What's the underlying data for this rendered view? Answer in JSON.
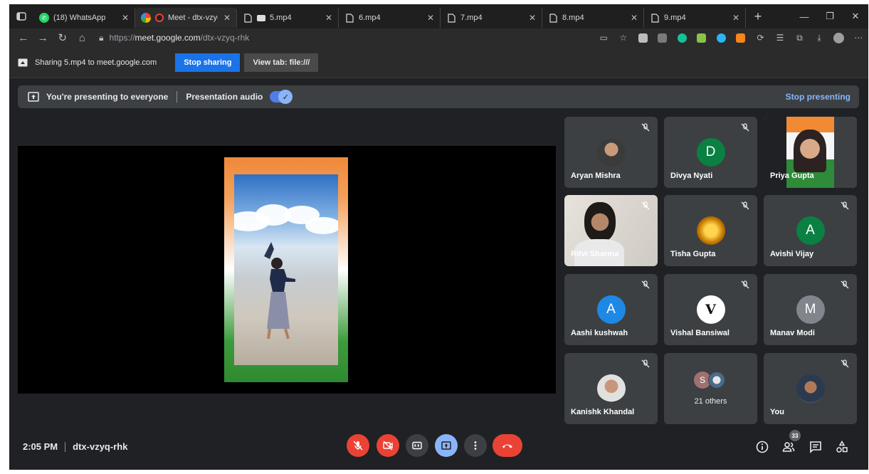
{
  "browser": {
    "tabs": [
      {
        "label": "(18) WhatsApp",
        "icon": "whatsapp-icon"
      },
      {
        "label": "Meet - dtx-vzyq-",
        "icon": "meet-icon",
        "active": true
      },
      {
        "label": "5.mp4",
        "icon": "file-icon"
      },
      {
        "label": "6.mp4",
        "icon": "file-icon"
      },
      {
        "label": "7.mp4",
        "icon": "file-icon"
      },
      {
        "label": "8.mp4",
        "icon": "file-icon"
      },
      {
        "label": "9.mp4",
        "icon": "file-icon"
      }
    ],
    "new_tab": "+",
    "url_prefix": "https://",
    "url_host": "meet.google.com",
    "url_path": "/dtx-vzyq-rhk"
  },
  "share_bar": {
    "text": "Sharing 5.mp4 to meet.google.com",
    "stop_label": "Stop sharing",
    "view_label": "View tab: file:///"
  },
  "presenting": {
    "text": "You're presenting to everyone",
    "audio_label": "Presentation audio",
    "audio_on": true,
    "stop_label": "Stop presenting"
  },
  "participants": [
    {
      "name": "Aryan Mishra",
      "type": "photo",
      "muted": true
    },
    {
      "name": "Divya Nyati",
      "type": "letter",
      "letter": "D",
      "color": "#0b8043",
      "muted": true
    },
    {
      "name": "Priya Gupta",
      "type": "video",
      "muted": true
    },
    {
      "name": "Ritvi Sharma",
      "type": "video",
      "muted": true
    },
    {
      "name": "Tisha Gupta",
      "type": "photo",
      "muted": true
    },
    {
      "name": "Avishi Vijay",
      "type": "letter",
      "letter": "A",
      "color": "#0b8043",
      "muted": true
    },
    {
      "name": "Aashi kushwah",
      "type": "letter",
      "letter": "A",
      "color": "#1e88e5",
      "muted": true
    },
    {
      "name": "Vishal Bansiwal",
      "type": "logo",
      "letter": "V",
      "muted": true
    },
    {
      "name": "Manav Modi",
      "type": "letter",
      "letter": "M",
      "color": "#80868b",
      "muted": true
    },
    {
      "name": "Kanishk Khandal",
      "type": "photo",
      "muted": true
    },
    {
      "name": "21 others",
      "type": "others",
      "letter": "S"
    },
    {
      "name": "You",
      "type": "photo",
      "muted": true
    }
  ],
  "footer": {
    "time": "2:05 PM",
    "meeting_code": "dtx-vzyq-rhk",
    "people_count": "33"
  },
  "colors": {
    "meet_bg": "#202124",
    "tile_bg": "#3c4043",
    "red": "#ea4335",
    "blue_active": "#8ab4f8",
    "accent": "#1a73e8"
  }
}
